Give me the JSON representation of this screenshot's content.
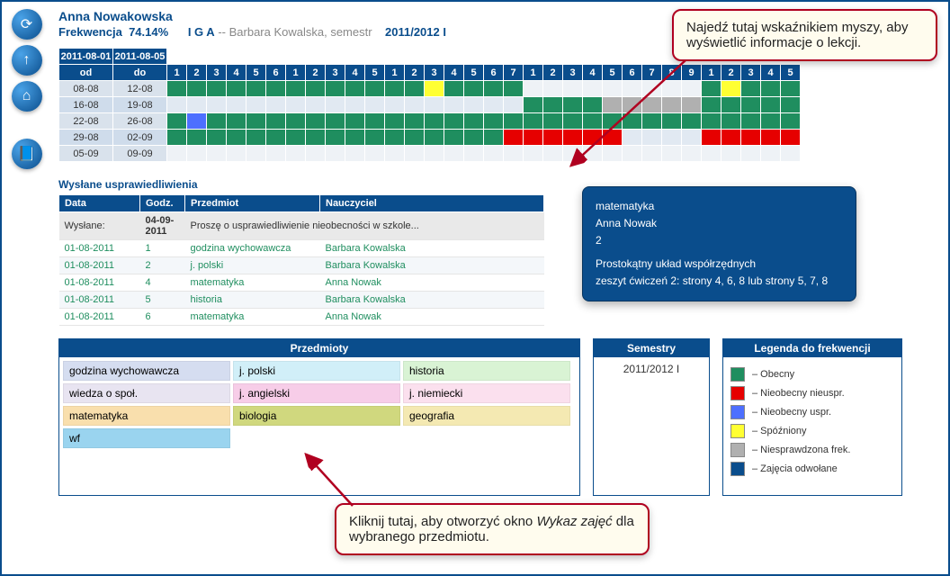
{
  "student_name": "Anna Nowakowska",
  "attendance_label": "Frekwencja",
  "attendance_pct": "74.14%",
  "class_code": "I G A",
  "teacher_line_sep": "--",
  "teacher_name": "Barbara Kowalska, semestr",
  "semester": "2011/2012 I",
  "grid_dates_top": [
    "2011-08-01",
    "2011-08-05"
  ],
  "grid_header_from": "od",
  "grid_header_to": "do",
  "grid_periods": [
    "1",
    "2",
    "3",
    "4",
    "5",
    "6",
    "1",
    "2",
    "3",
    "4",
    "5",
    "1",
    "2",
    "3",
    "4",
    "5",
    "6",
    "7",
    "1",
    "2",
    "3",
    "4",
    "5",
    "6",
    "7",
    "8",
    "9",
    "1",
    "2",
    "3",
    "4",
    "5"
  ],
  "grid_rows": [
    {
      "from": "08-08",
      "to": "12-08",
      "cells": [
        "g",
        "g",
        "g",
        "g",
        "g",
        "g",
        "g",
        "g",
        "g",
        "g",
        "g",
        "g",
        "g",
        "y",
        "g",
        "g",
        "g",
        "g",
        "e",
        "e",
        "e",
        "e",
        "e",
        "e",
        "e",
        "e",
        "e",
        "g",
        "y",
        "g",
        "g",
        "g"
      ]
    },
    {
      "from": "16-08",
      "to": "19-08",
      "cells": [
        "e",
        "e",
        "e",
        "e",
        "e",
        "e",
        "e",
        "e",
        "e",
        "e",
        "e",
        "e",
        "e",
        "e",
        "e",
        "e",
        "e",
        "e",
        "g",
        "g",
        "g",
        "g",
        "x",
        "x",
        "x",
        "x",
        "x",
        "g",
        "g",
        "g",
        "g",
        "g"
      ]
    },
    {
      "from": "22-08",
      "to": "26-08",
      "cells": [
        "g",
        "b",
        "g",
        "g",
        "g",
        "g",
        "g",
        "g",
        "g",
        "g",
        "g",
        "g",
        "g",
        "g",
        "g",
        "g",
        "g",
        "g",
        "g",
        "g",
        "g",
        "g",
        "g",
        "g",
        "g",
        "g",
        "g",
        "g",
        "g",
        "g",
        "g",
        "g"
      ]
    },
    {
      "from": "29-08",
      "to": "02-09",
      "cells": [
        "g",
        "g",
        "g",
        "g",
        "g",
        "g",
        "g",
        "g",
        "g",
        "g",
        "g",
        "g",
        "g",
        "g",
        "g",
        "g",
        "g",
        "r",
        "r",
        "r",
        "r",
        "r",
        "r",
        "e",
        "e",
        "e",
        "e",
        "r",
        "r",
        "r",
        "r",
        "r"
      ]
    },
    {
      "from": "05-09",
      "to": "09-09",
      "cells": [
        "e",
        "e",
        "e",
        "e",
        "e",
        "e",
        "e",
        "e",
        "e",
        "e",
        "e",
        "e",
        "e",
        "e",
        "e",
        "e",
        "e",
        "e",
        "e",
        "e",
        "e",
        "e",
        "e",
        "e",
        "e",
        "e",
        "e",
        "e",
        "e",
        "e",
        "e",
        "e"
      ]
    }
  ],
  "tooltip": {
    "subject": "matematyka",
    "teacher": "Anna Nowak",
    "lesson_no": "2",
    "topic": "Prostokątny układ współrzędnych",
    "homework": "zeszyt ćwiczeń 2: strony 4, 6, 8 lub strony 5, 7, 8"
  },
  "callouts": {
    "top": "Najedź tutaj wskaźnikiem myszy, aby wyświetlić informacje o lekcji.",
    "bottom_pre": "Kliknij tutaj, aby otworzyć okno ",
    "bottom_em": "Wykaz zajęć",
    "bottom_post": " dla wybranego przedmiotu."
  },
  "excuses": {
    "title": "Wysłane usprawiedliwienia",
    "headers": [
      "Data",
      "Godz.",
      "Przedmiot",
      "Nauczyciel"
    ],
    "sent_row": {
      "label": "Wysłane:",
      "date": "04-09-2011",
      "text": "Proszę o usprawiedliwienie nieobecności w szkole..."
    },
    "rows": [
      {
        "date": "01-08-2011",
        "h": "1",
        "subj": "godzina wychowawcza",
        "teacher": "Barbara Kowalska"
      },
      {
        "date": "01-08-2011",
        "h": "2",
        "subj": "j. polski",
        "teacher": "Barbara Kowalska"
      },
      {
        "date": "01-08-2011",
        "h": "4",
        "subj": "matematyka",
        "teacher": "Anna Nowak"
      },
      {
        "date": "01-08-2011",
        "h": "5",
        "subj": "historia",
        "teacher": "Barbara Kowalska"
      },
      {
        "date": "01-08-2011",
        "h": "6",
        "subj": "matematyka",
        "teacher": "Anna Nowak"
      }
    ]
  },
  "subjects": {
    "title": "Przedmioty",
    "items": [
      {
        "name": "godzina wychowawcza",
        "c": "c0"
      },
      {
        "name": "j. polski",
        "c": "c1"
      },
      {
        "name": "historia",
        "c": "c2"
      },
      {
        "name": "wiedza o społ.",
        "c": "c3"
      },
      {
        "name": "j. angielski",
        "c": "c4"
      },
      {
        "name": "j. niemiecki",
        "c": "c5"
      },
      {
        "name": "matematyka",
        "c": "c6"
      },
      {
        "name": "biologia",
        "c": "c7"
      },
      {
        "name": "geografia",
        "c": "c8"
      },
      {
        "name": "wf",
        "c": "c9"
      }
    ]
  },
  "semesters": {
    "title": "Semestry",
    "value": "2011/2012 I"
  },
  "legend": {
    "title": "Legenda do frekwencji",
    "items": [
      {
        "cls": "g",
        "label": "– Obecny"
      },
      {
        "cls": "r",
        "label": "– Nieobecny nieuspr."
      },
      {
        "cls": "b",
        "label": "– Nieobecny uspr."
      },
      {
        "cls": "y",
        "label": "– Spóźniony"
      },
      {
        "cls": "x",
        "label": "– Niesprawdzona frek."
      },
      {
        "cls": "d",
        "label": "– Zajęcia odwołane"
      }
    ]
  }
}
